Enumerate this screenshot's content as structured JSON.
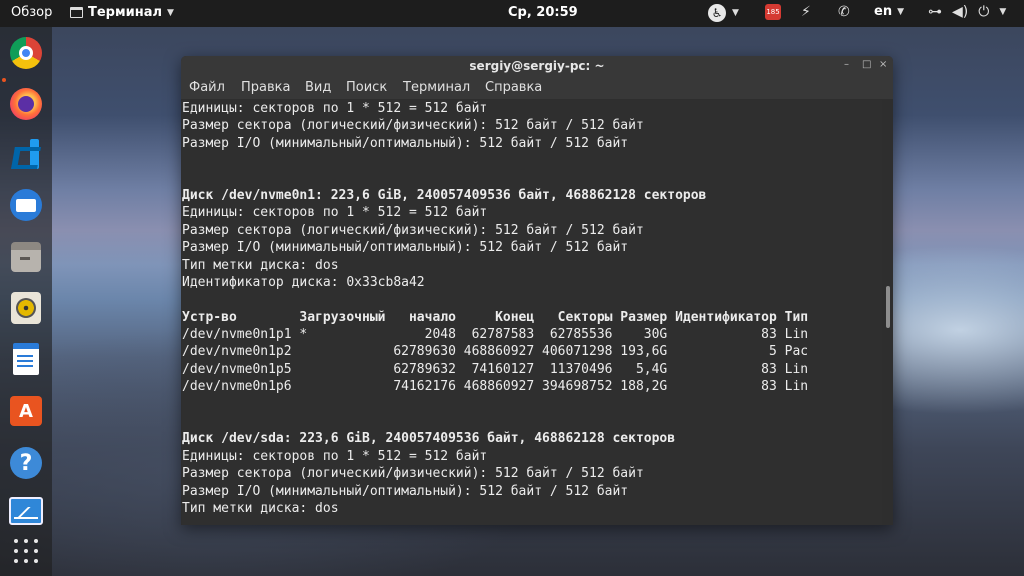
{
  "topbar": {
    "activities": "Обзор",
    "app_name": "Терминал",
    "clock": "Ср, 20:59",
    "notification_count": "185",
    "language": "en",
    "icons": [
      "app-icon",
      "accessibility-icon",
      "calendar-badge-icon",
      "indicator-icon",
      "messaging-icon",
      "network-icon",
      "volume-icon",
      "power-icon"
    ]
  },
  "dock": {
    "apps": [
      "chrome",
      "firefox",
      "vscode",
      "thunderbird",
      "files",
      "rhythmbox",
      "libreoffice-writer",
      "ubuntu-software",
      "help",
      "system-monitor",
      "show-applications"
    ]
  },
  "window": {
    "title": "sergiy@sergiy-pc: ~",
    "controls": {
      "minimize": "–",
      "maximize": "□",
      "close": "×"
    },
    "menu": [
      "Файл",
      "Правка",
      "Вид",
      "Поиск",
      "Терминал",
      "Справка"
    ]
  },
  "terminal": {
    "lines": [
      "Единицы: секторов по 1 * 512 = 512 байт",
      "Размер сектора (логический/физический): 512 байт / 512 байт",
      "Размер I/O (минимальный/оптимальный): 512 байт / 512 байт",
      "",
      "",
      "Диск /dev/nvme0n1: 223,6 GiB, 240057409536 байт, 468862128 секторов",
      "Единицы: секторов по 1 * 512 = 512 байт",
      "Размер сектора (логический/физический): 512 байт / 512 байт",
      "Размер I/O (минимальный/оптимальный): 512 байт / 512 байт",
      "Тип метки диска: dos",
      "Идентификатор диска: 0x33cb8a42",
      "",
      "Устр-во        Загрузочный   начало     Конец   Секторы Размер Идентификатор Тип",
      "/dev/nvme0n1p1 *               2048  62787583  62785536    30G            83 Lin",
      "/dev/nvme0n1p2             62789630 468860927 406071298 193,6G             5 Рас",
      "/dev/nvme0n1p5             62789632  74160127  11370496   5,4G            83 Lin",
      "/dev/nvme0n1p6             74162176 468860927 394698752 188,2G            83 Lin",
      "",
      "",
      "Диск /dev/sda: 223,6 GiB, 240057409536 байт, 468862128 секторов",
      "Единицы: секторов по 1 * 512 = 512 байт",
      "Размер сектора (логический/физический): 512 байт / 512 байт",
      "Размер I/O (минимальный/оптимальный): 512 байт / 512 байт",
      "Тип метки диска: dos"
    ],
    "bold_lines": [
      5,
      12,
      19
    ]
  }
}
